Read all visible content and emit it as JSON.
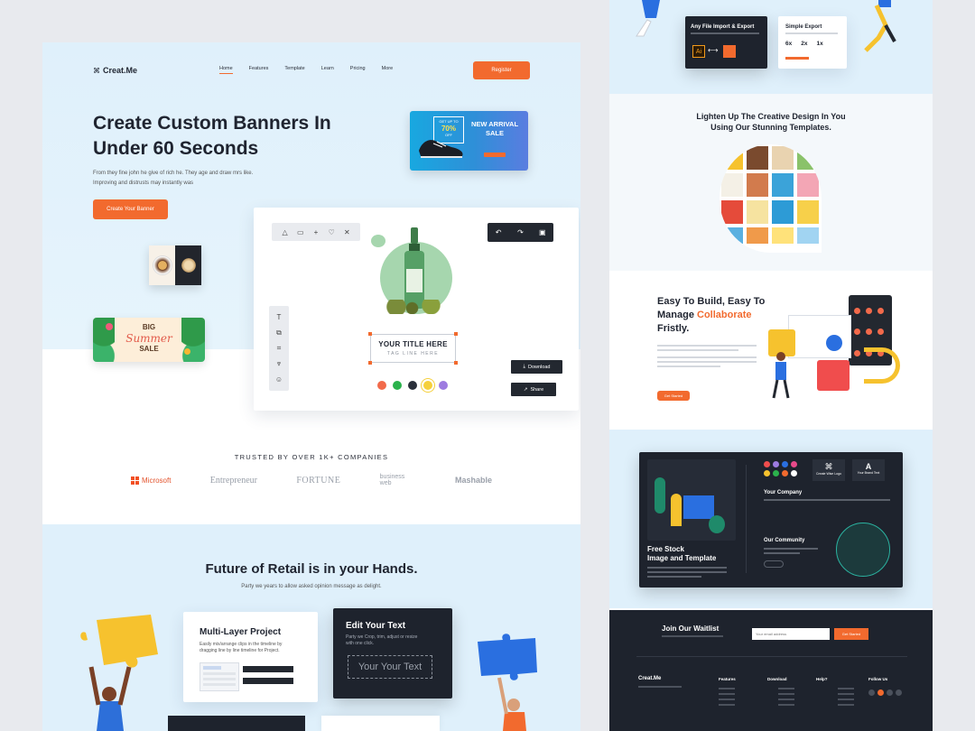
{
  "brand": {
    "name": "Creat.Me",
    "accent": "#f26a2e"
  },
  "nav": {
    "items": [
      "Home",
      "Features",
      "Template",
      "Learn",
      "Pricing",
      "More"
    ],
    "register": "Register"
  },
  "hero": {
    "title_line1": "Create Custom Banners In",
    "title_line2": "Under 60 Seconds",
    "desc_line1": "From they fine john he give of rich he. They age and draw mrs like.",
    "desc_line2": "Improving and distrusts may instantly was",
    "cta": "Create Your Banner"
  },
  "banner_ad": {
    "line1": "GET UP TO",
    "line2": "70%",
    "line3": "OFF",
    "title1": "NEW ARRIVAL",
    "title2": "SALE"
  },
  "summer": {
    "big": "BIG",
    "summer": "Summer",
    "sale": "SALE"
  },
  "editor": {
    "title": "YOUR TITLE HERE",
    "tagline": "TAG LINE HERE",
    "download": "Download",
    "share": "Share",
    "palette": [
      "#f26a4b",
      "#2bb24c",
      "#2a2f3a",
      "#f5d03b",
      "#9d7be0"
    ]
  },
  "trusted": {
    "label": "TRUSTED BY OVER 1K+ COMPANIES",
    "logos": [
      "Microsoft",
      "Entrepreneur",
      "FORTUNE",
      "business web",
      "Mashable"
    ]
  },
  "retail": {
    "title": "Future of Retail is in your Hands.",
    "subtitle": "Party we years to allow asked opinion  message as delight.",
    "card1_title": "Multi-Layer Project",
    "card1_desc1": "Easily mix/arrange clips in the timeline by",
    "card1_desc2": "dragging line by line timeline for Project.",
    "card2_title": "Edit Your Text",
    "card2_desc1": "Party we Crop, trim, adjust or resize",
    "card2_desc2": "with one click.",
    "card2_sample": "Your Your Text"
  },
  "right": {
    "import_title": "Any File Import & Export",
    "export_title": "Simple Export",
    "export_sizes": [
      "6x",
      "2x",
      "1x"
    ],
    "templates_title1": "Lighten Up The Creative Design In You",
    "templates_title2": "Using Our Stunning Templates.",
    "build_title1": "Easy To Build, Easy To",
    "build_title2a": "Manage ",
    "build_title2b": "Collaborate",
    "build_title3": "Fristly.",
    "build_btn": "Get Started",
    "company": "Your Company",
    "community": "Our Community",
    "stock1": "Free Stock",
    "stock2": "Image and Template",
    "logo_label": "Create Wise Logo",
    "brand_text": "Your Brand Text",
    "waitlist_title": "Join Our Waitlist",
    "waitlist_placeholder": "Your email address",
    "waitlist_btn": "Get Started",
    "footer_cols": [
      "Features",
      "Download",
      "Help?",
      "Follow Us"
    ]
  }
}
